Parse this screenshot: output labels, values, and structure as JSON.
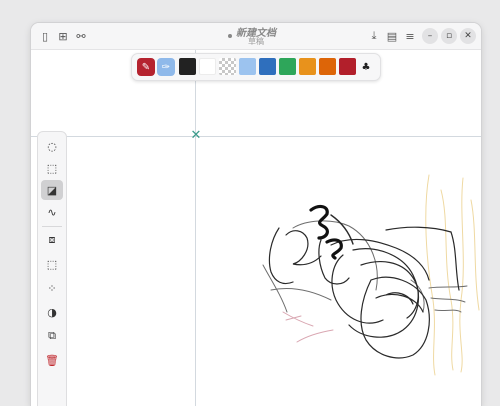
{
  "window": {
    "title": "新建文档",
    "subtitle": "草稿"
  },
  "titlebar": {
    "left_icons": [
      "sidebar-icon",
      "new-page-icon",
      "link-icon"
    ],
    "right_icons": [
      "download-icon",
      "document-icon",
      "menu-icon"
    ],
    "controls": [
      "minimize-icon",
      "maximize-icon",
      "close-icon"
    ],
    "glyphs": {
      "sidebar": "▯",
      "new_page": "⊞",
      "link": "⚯",
      "download": "⤓",
      "document": "▤",
      "menu": "≡",
      "minimize": "–",
      "maximize": "▫",
      "close": "✕"
    }
  },
  "palette": {
    "tools": [
      {
        "name": "pen-tool",
        "color": "#b5232f",
        "glyph": "✎",
        "selected": true
      },
      {
        "name": "marker-tool",
        "color": "#8fb9ea",
        "glyph": "✑",
        "selected": false
      }
    ],
    "colors": [
      "#222222",
      "#ffffff",
      "transparent",
      "#9cc3ef",
      "#2f6fbd",
      "#2ea65a",
      "#e8921c",
      "#dd6508",
      "#b21f2b"
    ],
    "more_glyph": "♣"
  },
  "sidebar": {
    "tools": [
      {
        "name": "lasso-icon",
        "glyph": "◌",
        "active": false
      },
      {
        "name": "rect-select-icon",
        "glyph": "⬚",
        "active": false
      },
      {
        "name": "fill-tool-icon",
        "glyph": "◪",
        "active": true
      },
      {
        "name": "curve-tool-icon",
        "glyph": "∿",
        "active": false
      }
    ],
    "actions": [
      {
        "name": "insert-image-icon",
        "glyph": "⧈"
      },
      {
        "name": "select-all-icon",
        "glyph": "⬚"
      },
      {
        "name": "resize-icon",
        "glyph": "⁘"
      },
      {
        "name": "contrast-icon",
        "glyph": "◑"
      },
      {
        "name": "duplicate-icon",
        "glyph": "⧉"
      },
      {
        "name": "delete-icon",
        "glyph": "🗑"
      }
    ]
  },
  "canvas": {
    "origin_marker": "✕",
    "colors": {
      "ink": "#2a2a2a",
      "gray": "#6d6d6d",
      "pink": "#d9a6b1",
      "yellow": "#efd9a2",
      "guide": "#d3d9df",
      "origin": "#3a9a8a"
    }
  }
}
